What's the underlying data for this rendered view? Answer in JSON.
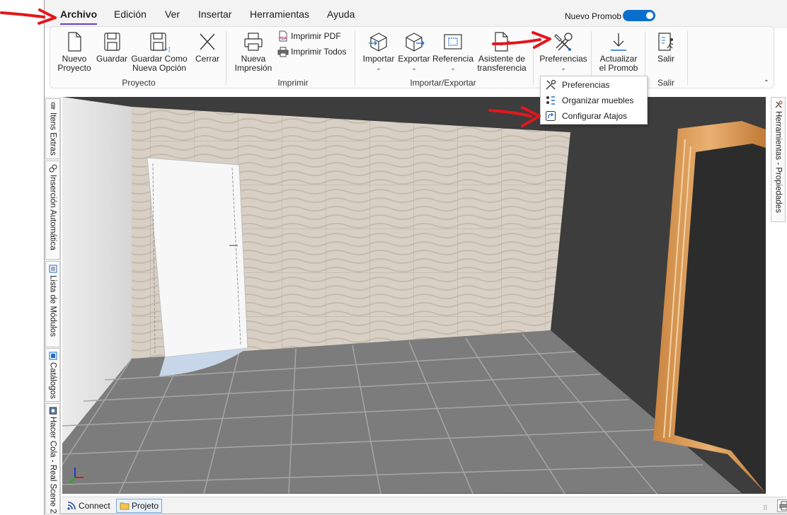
{
  "menu": {
    "items": [
      {
        "label": "Archivo",
        "active": true
      },
      {
        "label": "Edición"
      },
      {
        "label": "Ver"
      },
      {
        "label": "Insertar"
      },
      {
        "label": "Herramientas"
      },
      {
        "label": "Ayuda"
      }
    ],
    "toggle_label": "Nuevo Promob",
    "toggle_on": true
  },
  "ribbon": {
    "groups": {
      "proyecto": "Proyecto",
      "imprimir": "Imprimir",
      "importar_exportar": "Importar/Exportar",
      "salir": "Salir"
    },
    "buttons": {
      "nuevo_proyecto": [
        "Nuevo",
        "Proyecto"
      ],
      "guardar": "Guardar",
      "guardar_como": [
        "Guardar Como",
        "Nueva Opción"
      ],
      "cerrar": "Cerrar",
      "nueva_impresion": [
        "Nueva",
        "Impresión"
      ],
      "imprimir_pdf": "Imprimir PDF",
      "imprimir_todos": "Imprimir Todos",
      "importar": "Importar",
      "exportar": "Exportar",
      "referencia": "Referencia",
      "asistente": [
        "Asistente de",
        "transferencia"
      ],
      "preferencias": "Preferencias",
      "actualizar": [
        "Actualizar",
        "el Promob"
      ],
      "salir": "Salir"
    }
  },
  "dropdown": {
    "items": [
      "Preferencias",
      "Organizar muebles",
      "Configurar Atajos"
    ]
  },
  "left_tabs": [
    "Itens Extras",
    "Inserción Automática",
    "Lista de Módulos",
    "Catálogos",
    "Hacer Cola - Real Scene 2"
  ],
  "right_tabs": [
    "Herramientas - Propiedades"
  ],
  "statusbar": {
    "connect": "Connect",
    "projeto": "Projeto",
    "close": "×"
  },
  "colors": {
    "accent": "#6a3fc7",
    "toggle": "#0a6fcc",
    "arrow": "#e3161b"
  }
}
